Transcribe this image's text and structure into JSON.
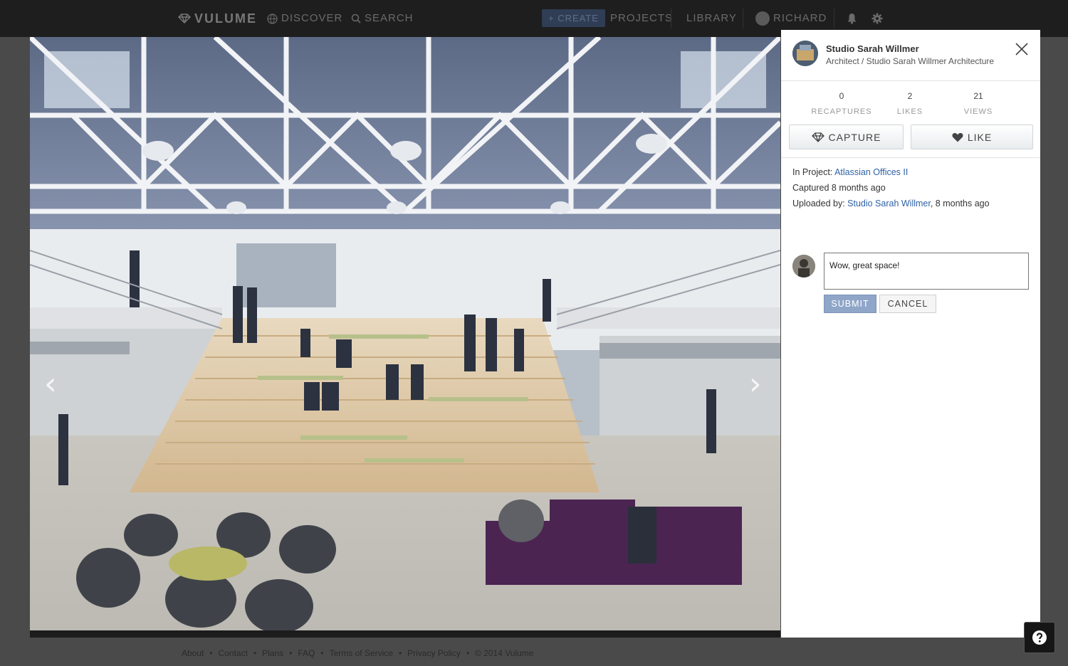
{
  "nav": {
    "logo": "VULUME",
    "discover": "DISCOVER",
    "search": "SEARCH",
    "create": "+ CREATE",
    "projects": "PROJECTS",
    "library": "LIBRARY",
    "user": "RICHARD"
  },
  "panel": {
    "name": "Studio Sarah Willmer",
    "role": "Architect / Studio Sarah Willmer Architecture",
    "stats": [
      {
        "value": "0",
        "label": "RECAPTURES"
      },
      {
        "value": "2",
        "label": "LIKES"
      },
      {
        "value": "21",
        "label": "VIEWS"
      }
    ],
    "capture_label": "CAPTURE",
    "like_label": "LIKE",
    "project_prefix": "In Project: ",
    "project_name": "Atlassian Offices II",
    "captured": "Captured 8 months ago",
    "uploaded_prefix": "Uploaded by: ",
    "uploaded_by": "Studio Sarah Willmer",
    "uploaded_suffix": ", 8 months ago",
    "comment_value": "Wow, great space!",
    "submit_label": "SUBMIT",
    "cancel_label": "CANCEL"
  },
  "viewer": {
    "prev_glyph": "‹",
    "next_glyph": "›"
  },
  "footer": {
    "links": [
      "About",
      "Contact",
      "Plans",
      "FAQ",
      "Terms of Service",
      "Privacy Policy"
    ],
    "copyright": "© 2014 Vulume",
    "separator": "•"
  },
  "colors": {
    "accent_link": "#2f62a5",
    "submit_bg": "#8fa6c9",
    "nav_bg": "#1e1e1e"
  },
  "icons": [
    "diamond-logo-icon",
    "globe-icon",
    "search-icon",
    "bell-icon",
    "gear-icon",
    "close-icon",
    "diamond-capture-icon",
    "heart-icon",
    "help-icon",
    "chevron-left-icon",
    "chevron-right-icon"
  ]
}
